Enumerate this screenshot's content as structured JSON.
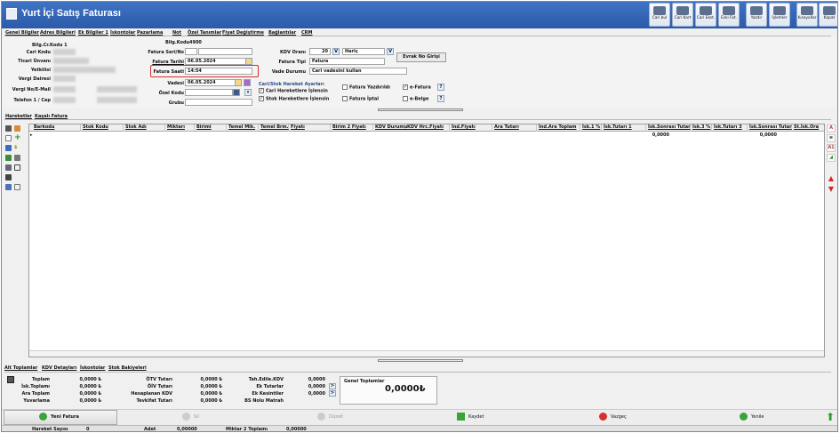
{
  "window": {
    "title": "Yurt İçi Satış Faturası"
  },
  "toolbar": [
    {
      "label": "Cari bul",
      "icon": "search-user-icon"
    },
    {
      "label": "Cari Kart",
      "icon": "user-card-icon"
    },
    {
      "label": "Cari Ekst.",
      "icon": "statement-icon"
    },
    {
      "label": "Eski Fat.",
      "icon": "old-invoice-icon"
    },
    {
      "label": "Yazdır",
      "icon": "printer-icon"
    },
    {
      "label": "İşlemler",
      "icon": "operations-icon"
    },
    {
      "label": "Kısayollar",
      "icon": "shortcuts-icon"
    },
    {
      "label": "Kapat",
      "icon": "close-icon"
    }
  ],
  "tabs": [
    "Genel Bilgiler",
    "Adres Bilgileri",
    "Ek Bilgiler 1",
    "İskontolar",
    "Pazarlama",
    "Not",
    "Özel Tanımlar",
    "Fiyat Değiştirme",
    "Bağlantılar",
    "CRM"
  ],
  "form": {
    "left_labels": [
      "Bilg.Cr.Kodu 1",
      "Cari Kodu",
      "Ticari Ünvanı",
      "Yetkilisi",
      "Vergi Dairesi",
      "Vergi No/E-Mail",
      "Telefon 1 / Cep"
    ],
    "bilg_kodu_label": "Bilg.Kodu",
    "bilg_kodu_value": "4900",
    "fatura_seri_label": "Fatura Seri/No",
    "fatura_tarihi_label": "Fatura Tarihi",
    "fatura_tarihi": "06.05.2024",
    "fatura_saati_label": "Fatura Saati",
    "fatura_saati": "14:54",
    "vadesi_label": "Vadesi",
    "vadesi": "06.05.2024",
    "ozel_kodu_label": "Özel Kodu",
    "grubu_label": "Grubu",
    "kdv_orani_label": "KDV Oranı",
    "kdv_orani": "20",
    "kdv_haric": "Hariç",
    "fatura_tipi_label": "Fatura Tipi",
    "fatura_tipi": "Fatura",
    "vade_durumu_label": "Vade Durumu",
    "vade_durumu": "Cari vadesini kullan",
    "evrak_button": "Evrak No Girişi",
    "settings_title": "Cari/Stok Hareket Ayarları",
    "cari_check": "Cari Hareketlere İşlensin",
    "stok_check": "Stok Hareketlere İşlensin",
    "yazdirildi": "Fatura Yazdırıldı",
    "iptal": "Fatura İptal",
    "efatura": "e-Fatura",
    "ebelge": "e-Belge"
  },
  "grid_tabs": [
    "Hareketler",
    "Kaşalı Fatura"
  ],
  "columns": [
    "Barkodu",
    "Stok Kodu",
    "Stok Adı",
    "Miktarı",
    "Birimi",
    "Temel Mik.",
    "Temel Brm.",
    "Fiyatı",
    "Birim 2 Fiyatı",
    "KDV Durumu",
    "KDV Hrc.Fiyatı",
    "İnd.Fiyatı",
    "Ara Tutarı",
    "İnd.Ara Toplam",
    "İsk.1 %",
    "İsk.Tutarı 1",
    "İsk.Sonrası Tutar",
    "İsk.3 %",
    "İsk.Tutarı 3",
    "İsk.Sonrası Tutar",
    "St.İsk.Ora"
  ],
  "grid_values": {
    "isk_tutari_1": "0,0000",
    "isk_tutari_3": "0,0000"
  },
  "bottom_tabs": [
    "Alt Toplamlar",
    "KDV Detayları",
    "İskontolar",
    "Stok Bakiyeleri"
  ],
  "totals": {
    "col1": [
      {
        "label": "Toplam",
        "value": "0,0000 ₺"
      },
      {
        "label": "İsk.Toplamı",
        "value": "0,0000 ₺"
      },
      {
        "label": "Ara Toplam",
        "value": "0,0000 ₺"
      },
      {
        "label": "Yuvarlama",
        "value": "0,0000 ₺"
      }
    ],
    "col2": [
      {
        "label": "ÖTV Tutarı",
        "value": "0,0000 ₺"
      },
      {
        "label": "ÖİV Tutarı",
        "value": "0,0000 ₺"
      },
      {
        "label": "Hesaplanan KDV",
        "value": "0,0000 ₺"
      },
      {
        "label": "Tevkifat Tutarı",
        "value": "0,0000 ₺"
      }
    ],
    "col3": [
      {
        "label": "Tah.Edile.KDV",
        "value": "0,0000"
      },
      {
        "label": "Ek Tutarlar",
        "value": "0,0000"
      },
      {
        "label": "Ek Kesintiler",
        "value": "0,0000"
      },
      {
        "label": "BS Nolu Matrah",
        "value": ""
      }
    ],
    "grand_label": "Genel Toplamlar",
    "grand_value": "0,0000₺"
  },
  "actions": {
    "new": "Yeni Fatura",
    "delete": "Sil",
    "edit": "Düzelt",
    "save": "Kaydet",
    "cancel": "Vazgeç",
    "refresh": "Yenile"
  },
  "status": {
    "hareket_label": "Hareket Sayısı",
    "hareket": "0",
    "adet_label": "Adet",
    "adet": "0,00000",
    "miktar2_label": "Miktar 2 Toplamı",
    "miktar2": "0,00000"
  },
  "colors": {
    "title": "#2f63b8",
    "highlight": "#d63030"
  }
}
